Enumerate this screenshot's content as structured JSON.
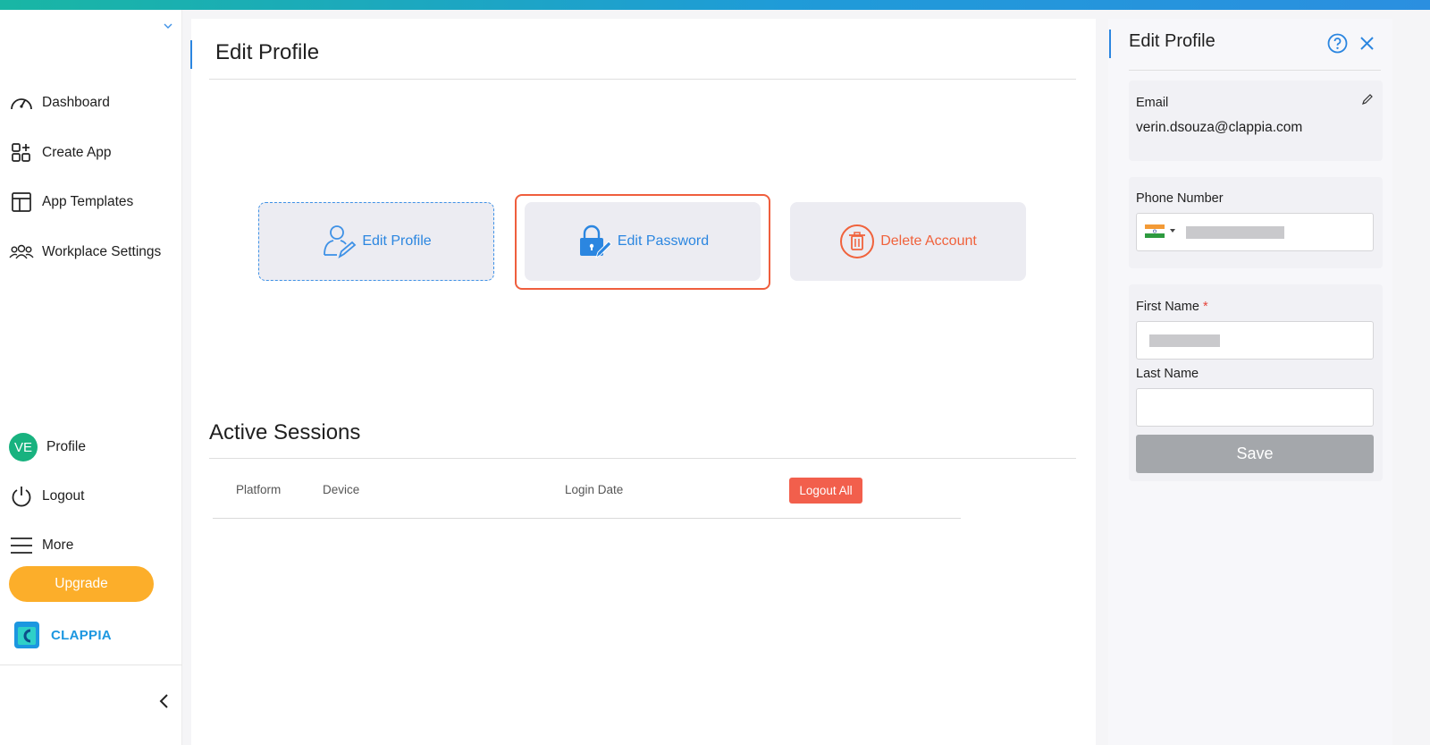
{
  "sidebar": {
    "items": [
      {
        "label": "Dashboard"
      },
      {
        "label": "Create App"
      },
      {
        "label": "App Templates"
      },
      {
        "label": "Workplace Settings"
      }
    ],
    "profile": {
      "initials": "VE",
      "label": "Profile"
    },
    "logout_label": "Logout",
    "more_label": "More",
    "upgrade_label": "Upgrade",
    "brand_name": "CLAPPIA"
  },
  "main": {
    "title": "Edit Profile",
    "cards": {
      "edit_profile": "Edit Profile",
      "edit_password": "Edit Password",
      "delete_account": "Delete Account"
    },
    "sessions": {
      "title": "Active Sessions",
      "columns": [
        "Platform",
        "Device",
        "Login Date"
      ],
      "logout_all_label": "Logout All"
    }
  },
  "panel": {
    "title": "Edit Profile",
    "email": {
      "label": "Email",
      "value": "verin.dsouza@clappia.com"
    },
    "phone": {
      "label": "Phone Number"
    },
    "first_name": {
      "label": "First Name",
      "required_mark": "*"
    },
    "last_name": {
      "label": "Last Name"
    },
    "save_label": "Save"
  },
  "colors": {
    "accent": "#2b86e0",
    "danger": "#f0623c",
    "upgrade": "#fcae2a",
    "avatar": "#18b27f"
  }
}
